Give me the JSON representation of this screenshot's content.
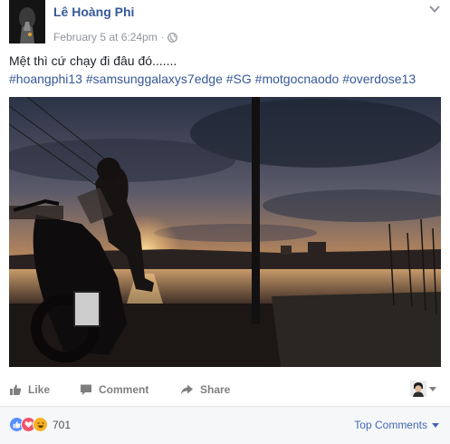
{
  "post": {
    "author": "Lê Hoàng Phi",
    "timestamp": "February 5 at 6:24pm",
    "separator": "·",
    "privacy_icon": "globe-icon",
    "menu_icon": "chevron-down-icon",
    "text": "Mệt thì cứ chạy đi đâu đó.......",
    "hashtags": [
      "#hoangphi13",
      "#samsunggalaxys7edge",
      "#SG",
      "#motgocnaodo",
      "#overdose13"
    ]
  },
  "actions": {
    "like_label": "Like",
    "comment_label": "Comment",
    "share_label": "Share"
  },
  "reactions": {
    "types": [
      "like",
      "love",
      "haha"
    ],
    "count": "701",
    "sort_label": "Top Comments"
  },
  "colors": {
    "link": "#365899",
    "meta": "#90949c",
    "action": "#7f7f7f",
    "like_blue": "#5890ff",
    "love_red": "#f25268",
    "haha_yellow": "#f7b125"
  }
}
